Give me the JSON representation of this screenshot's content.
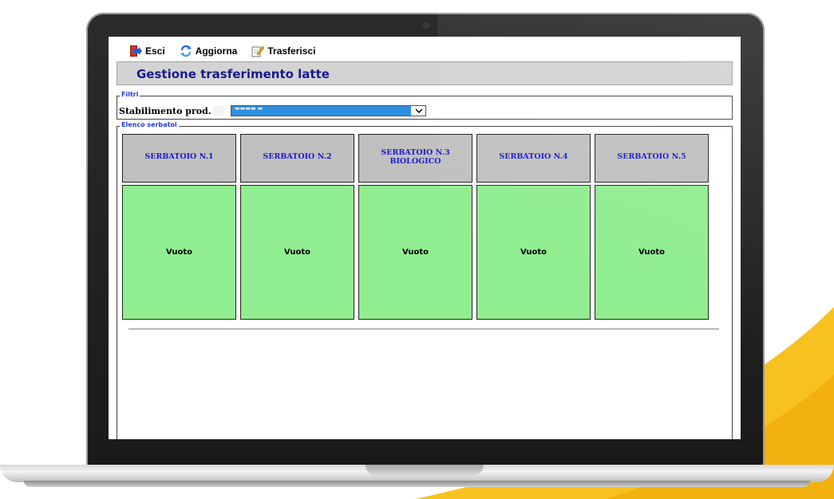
{
  "toolbar": {
    "esci": "Esci",
    "aggiorna": "Aggiorna",
    "trasferisci": "Trasferisci"
  },
  "page": {
    "title": "Gestione trasferimento latte"
  },
  "filters": {
    "legend": "Filtri",
    "stabilimento_label": "Stabilimento prod.",
    "stabilimento_value": "▬▬▬▬ ▬"
  },
  "tanks_section": {
    "legend": "Elenco serbatoi",
    "tanks": [
      {
        "name": "SERBATOIO N.1",
        "status": "Vuoto"
      },
      {
        "name": "SERBATOIO N.2",
        "status": "Vuoto"
      },
      {
        "name": "SERBATOIO N.3\nBIOLOGICO",
        "status": "Vuoto"
      },
      {
        "name": "SERBATOIO N.4",
        "status": "Vuoto"
      },
      {
        "name": "SERBATOIO N.5",
        "status": "Vuoto"
      }
    ]
  },
  "colors": {
    "tank_empty": "#90ee90",
    "tank_header": "#c0c0c0",
    "title_text": "#1a1a8c",
    "tank_name_text": "#1a1ad0",
    "select_highlight": "#2f8fe0"
  }
}
